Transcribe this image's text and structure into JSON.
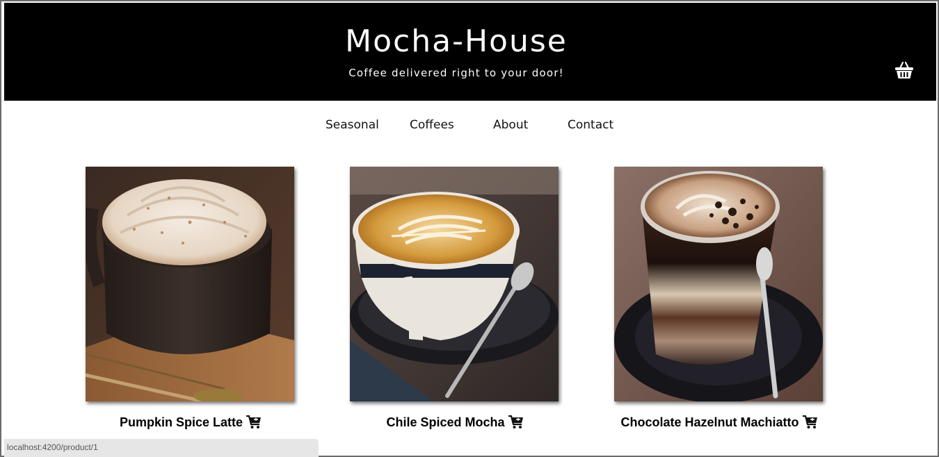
{
  "header": {
    "title": "Mocha-House",
    "subtitle": "Coffee delivered right to your door!",
    "cart_icon": "basket-icon"
  },
  "nav": {
    "items": [
      {
        "label": "Seasonal"
      },
      {
        "label": "Coffees"
      },
      {
        "label": "About"
      },
      {
        "label": "Contact"
      }
    ]
  },
  "products": [
    {
      "name": "Pumpkin Spice Latte",
      "icon": "add-to-cart-icon"
    },
    {
      "name": "Chile Spiced Mocha",
      "icon": "add-to-cart-icon"
    },
    {
      "name": "Chocolate Hazelnut Machiatto",
      "icon": "add-to-cart-icon"
    }
  ],
  "status_bar": {
    "url": "localhost:4200/product/1"
  },
  "colors": {
    "header_bg": "#000000",
    "header_text": "#ffffff",
    "page_bg": "#ffffff"
  }
}
